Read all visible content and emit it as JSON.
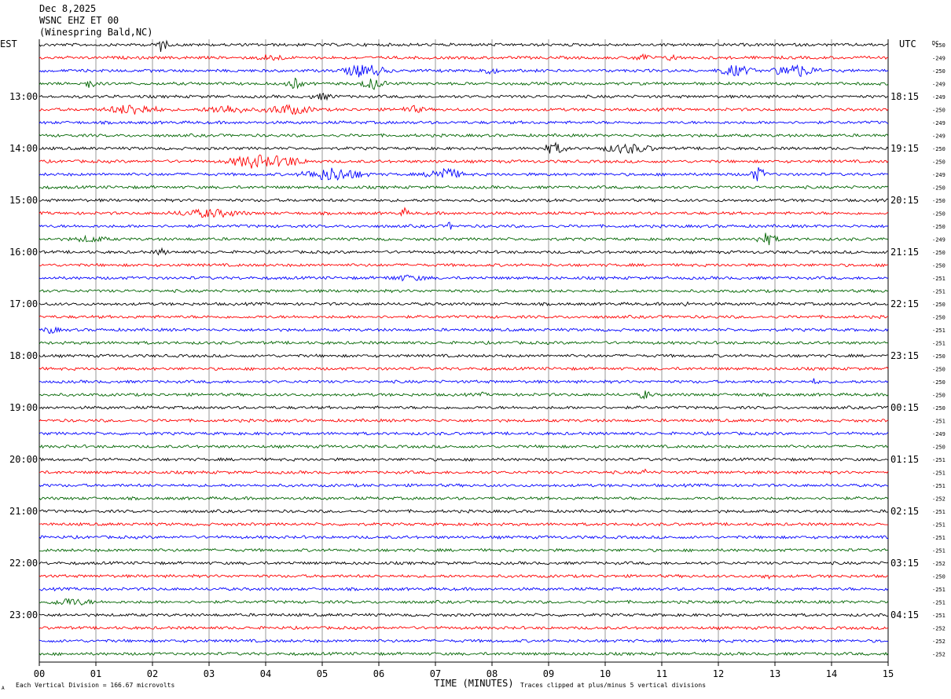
{
  "header": {
    "date": "Dec 8,2025",
    "station": "WSNC EHZ ET 00",
    "location": "(Winespring Bald,NC)"
  },
  "labels": {
    "left_tz": "EST",
    "right_tz": "UTC",
    "dc": "DC",
    "xlabel": "TIME (MINUTES)",
    "footer_left": "Each Vertical Division =  166.67 microvolts",
    "footer_right": "Traces clipped at plus/minus 5 vertical divisions",
    "corner_mark": "A"
  },
  "colors": {
    "cycle": [
      "#000000",
      "#ff0000",
      "#0000ff",
      "#006400"
    ],
    "grid": "#808080"
  },
  "chart_data": {
    "type": "line",
    "title": "",
    "xlabel": "TIME (MINUTES)",
    "x_range": [
      0,
      15
    ],
    "x_ticks": [
      "00",
      "01",
      "02",
      "03",
      "04",
      "05",
      "06",
      "07",
      "08",
      "09",
      "10",
      "11",
      "12",
      "13",
      "14",
      "15"
    ],
    "trace_count": 48,
    "trace_minutes": 15,
    "left_hour_labels": [
      {
        "trace": 4,
        "label": "13:00"
      },
      {
        "trace": 8,
        "label": "14:00"
      },
      {
        "trace": 12,
        "label": "15:00"
      },
      {
        "trace": 16,
        "label": "16:00"
      },
      {
        "trace": 20,
        "label": "17:00"
      },
      {
        "trace": 24,
        "label": "18:00"
      },
      {
        "trace": 28,
        "label": "19:00"
      },
      {
        "trace": 32,
        "label": "20:00"
      },
      {
        "trace": 36,
        "label": "21:00"
      },
      {
        "trace": 40,
        "label": "22:00"
      },
      {
        "trace": 44,
        "label": "23:00"
      }
    ],
    "right_hour_labels": [
      {
        "trace": 4,
        "label": "18:15"
      },
      {
        "trace": 8,
        "label": "19:15"
      },
      {
        "trace": 12,
        "label": "20:15"
      },
      {
        "trace": 16,
        "label": "21:15"
      },
      {
        "trace": 20,
        "label": "22:15"
      },
      {
        "trace": 24,
        "label": "23:15"
      },
      {
        "trace": 28,
        "label": "00:15"
      },
      {
        "trace": 32,
        "label": "01:15"
      },
      {
        "trace": 36,
        "label": "02:15"
      },
      {
        "trace": 40,
        "label": "03:15"
      },
      {
        "trace": 44,
        "label": "04:15"
      }
    ],
    "dc_offsets": [
      "-250",
      "-249",
      "-250",
      "-249",
      "-249",
      "-250",
      "-249",
      "-249",
      "-250",
      "-250",
      "-249",
      "-250",
      "-250",
      "-250",
      "-250",
      "-249",
      "-250",
      "-250",
      "-251",
      "-251",
      "-250",
      "-250",
      "-251",
      "-251",
      "-250",
      "-250",
      "-250",
      "-250",
      "-250",
      "-251",
      "-249",
      "-250",
      "-251",
      "-251",
      "-251",
      "-252",
      "-251",
      "-251",
      "-251",
      "-251",
      "-252",
      "-250",
      "-251",
      "-251",
      "-251",
      "-252",
      "-252",
      "-252"
    ],
    "events": [
      {
        "trace": 0,
        "minute": 2.15,
        "amp": 1.0,
        "dur": 0.15
      },
      {
        "trace": 1,
        "minute": 4.1,
        "amp": 0.45,
        "dur": 0.3
      },
      {
        "trace": 1,
        "minute": 10.65,
        "amp": 0.45,
        "dur": 0.2
      },
      {
        "trace": 1,
        "minute": 11.2,
        "amp": 0.4,
        "dur": 0.15
      },
      {
        "trace": 2,
        "minute": 5.75,
        "amp": 0.9,
        "dur": 0.5
      },
      {
        "trace": 2,
        "minute": 7.9,
        "amp": 0.35,
        "dur": 0.3
      },
      {
        "trace": 2,
        "minute": 12.3,
        "amp": 0.7,
        "dur": 0.4
      },
      {
        "trace": 2,
        "minute": 13.35,
        "amp": 0.9,
        "dur": 0.5
      },
      {
        "trace": 3,
        "minute": 0.9,
        "amp": 0.6,
        "dur": 0.15
      },
      {
        "trace": 3,
        "minute": 4.5,
        "amp": 0.7,
        "dur": 0.2
      },
      {
        "trace": 3,
        "minute": 5.9,
        "amp": 0.7,
        "dur": 0.3
      },
      {
        "trace": 4,
        "minute": 5.0,
        "amp": 0.35,
        "dur": 0.3
      },
      {
        "trace": 5,
        "minute": 1.65,
        "amp": 0.7,
        "dur": 0.6
      },
      {
        "trace": 5,
        "minute": 3.3,
        "amp": 0.6,
        "dur": 0.5
      },
      {
        "trace": 5,
        "minute": 4.4,
        "amp": 0.6,
        "dur": 0.6
      },
      {
        "trace": 5,
        "minute": 6.6,
        "amp": 0.4,
        "dur": 0.3
      },
      {
        "trace": 8,
        "minute": 9.1,
        "amp": 0.7,
        "dur": 0.3
      },
      {
        "trace": 8,
        "minute": 10.4,
        "amp": 0.6,
        "dur": 0.6
      },
      {
        "trace": 9,
        "minute": 3.8,
        "amp": 0.9,
        "dur": 0.6
      },
      {
        "trace": 9,
        "minute": 4.4,
        "amp": 0.6,
        "dur": 0.4
      },
      {
        "trace": 10,
        "minute": 5.2,
        "amp": 0.9,
        "dur": 0.7
      },
      {
        "trace": 10,
        "minute": 7.15,
        "amp": 0.9,
        "dur": 0.4
      },
      {
        "trace": 10,
        "minute": 12.7,
        "amp": 0.9,
        "dur": 0.2
      },
      {
        "trace": 13,
        "minute": 3.0,
        "amp": 0.5,
        "dur": 0.8
      },
      {
        "trace": 13,
        "minute": 6.45,
        "amp": 0.6,
        "dur": 0.1
      },
      {
        "trace": 14,
        "minute": 7.25,
        "amp": 0.6,
        "dur": 0.05
      },
      {
        "trace": 15,
        "minute": 0.9,
        "amp": 0.35,
        "dur": 0.4
      },
      {
        "trace": 15,
        "minute": 12.85,
        "amp": 0.8,
        "dur": 0.25
      },
      {
        "trace": 16,
        "minute": 2.15,
        "amp": 0.4,
        "dur": 0.15
      },
      {
        "trace": 18,
        "minute": 6.5,
        "amp": 0.3,
        "dur": 0.5
      },
      {
        "trace": 20,
        "minute": 11.4,
        "amp": 0.3,
        "dur": 0.1
      },
      {
        "trace": 22,
        "minute": 0.2,
        "amp": 0.4,
        "dur": 0.2
      },
      {
        "trace": 26,
        "minute": 13.7,
        "amp": 0.35,
        "dur": 0.1
      },
      {
        "trace": 27,
        "minute": 10.7,
        "amp": 0.6,
        "dur": 0.15
      },
      {
        "trace": 27,
        "minute": 7.85,
        "amp": 0.35,
        "dur": 0.05
      },
      {
        "trace": 33,
        "minute": 10.7,
        "amp": 0.35,
        "dur": 0.1
      },
      {
        "trace": 41,
        "minute": 12.85,
        "amp": 0.35,
        "dur": 0.1
      },
      {
        "trace": 43,
        "minute": 0.55,
        "amp": 0.45,
        "dur": 0.5
      }
    ]
  }
}
